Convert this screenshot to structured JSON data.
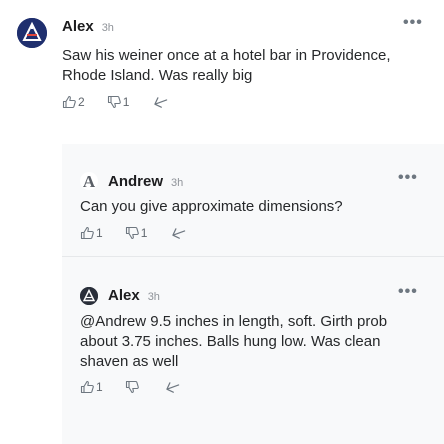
{
  "comment": {
    "author": "Alex",
    "time": "3h",
    "text": "Saw his weiner once at a hotel bar in Providence, Rhode Island. Was really big",
    "likes": "2",
    "dislikes": "1"
  },
  "replies": [
    {
      "author": "Andrew",
      "avatar_letter": "A",
      "time": "3h",
      "text": "Can you give approximate dimensions?",
      "likes": "1",
      "dislikes": "1"
    },
    {
      "author": "Alex",
      "time": "3h",
      "text": "@Andrew 9.5 inches in length, soft. Girth prob about 3.75 inches. Balls hung low. Was clean shaven as well",
      "likes": "1",
      "dislikes": ""
    }
  ],
  "icons": {
    "more": "more-icon",
    "like": "thumbs-up-icon",
    "dislike": "thumbs-down-icon",
    "reply": "reply-icon"
  },
  "colors": {
    "avatar_main": "#1f2f6e",
    "muted": "#6e7780",
    "card_bg": "#f8f9fa"
  }
}
